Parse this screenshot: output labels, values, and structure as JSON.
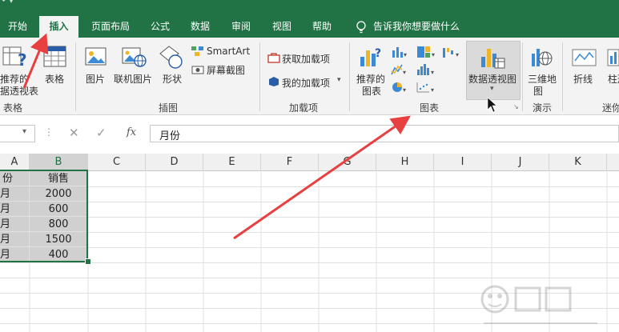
{
  "tabs": [
    {
      "label": "开始",
      "active": false
    },
    {
      "label": "插入",
      "active": true
    },
    {
      "label": "页面布局",
      "active": false
    },
    {
      "label": "公式",
      "active": false
    },
    {
      "label": "数据",
      "active": false
    },
    {
      "label": "审阅",
      "active": false
    },
    {
      "label": "视图",
      "active": false
    },
    {
      "label": "帮助",
      "active": false
    }
  ],
  "tell_me": "告诉我你想要做什么",
  "ribbon": {
    "tables": {
      "recommended_pivot_line1": "推荐的",
      "recommended_pivot_line2": "据透视表",
      "table": "表格",
      "group": "表格"
    },
    "illustrations": {
      "pictures": "图片",
      "online_pictures": "联机图片",
      "shapes": "形状",
      "smartart": "SmartArt",
      "screenshot": "屏幕截图",
      "group": "插图"
    },
    "addins": {
      "get_addins": "获取加载项",
      "my_addins": "我的加载项",
      "group": "加载项"
    },
    "charts": {
      "recommended_line1": "推荐的",
      "recommended_line2": "图表",
      "pivot_chart": "数据透视图",
      "group": "图表"
    },
    "tours": {
      "map_line1": "三维地",
      "map_line2": "图",
      "group": "演示"
    },
    "sparklines": {
      "line": "折线",
      "column": "柱形",
      "group": "迷你"
    }
  },
  "formula_bar": {
    "fx": "fx",
    "value": "月份"
  },
  "columns": [
    "A",
    "B",
    "C",
    "D",
    "E",
    "F",
    "G",
    "H",
    "I",
    "J",
    "K"
  ],
  "rows": [
    {
      "a": "份",
      "b": "销售"
    },
    {
      "a": "月",
      "b": "2000"
    },
    {
      "a": "月",
      "b": "600"
    },
    {
      "a": "月",
      "b": "800"
    },
    {
      "a": "月",
      "b": "1500"
    },
    {
      "a": "月",
      "b": "400"
    }
  ],
  "colors": {
    "excel_green": "#217346",
    "selection_fill": "#d0d0d0",
    "arrow_red": "#e84040"
  }
}
